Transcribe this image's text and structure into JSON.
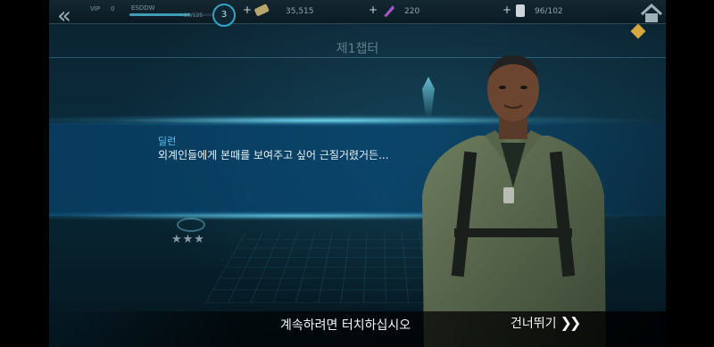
{
  "topbar": {
    "back_icon": "double-chevron-left-icon",
    "vip_label": "VIP",
    "vip_level": "0",
    "user_name": "ESDDW",
    "exp_text": "90/125",
    "exp_fraction": 0.72,
    "player_level": "3",
    "resources": [
      {
        "name": "credits",
        "icon": "credits-icon",
        "value": "35,515"
      },
      {
        "name": "energy",
        "icon": "energy-icon",
        "value": "220"
      },
      {
        "name": "stamina",
        "icon": "stamina-icon",
        "value": "96/102"
      }
    ],
    "home_icon": "home-icon"
  },
  "chapter": {
    "title": "제1챕터"
  },
  "map": {
    "stars": "★★★"
  },
  "dialogue": {
    "speaker": "딜런",
    "text": "외계인들에게 본때를 보여주고 싶어 근질거렸거든..."
  },
  "footer": {
    "continue_hint": "계속하려면 터치하십시오",
    "skip_label": "건너뛰기",
    "skip_icon": "double-chevron-right-icon"
  },
  "colors": {
    "accent": "#58c6f0",
    "band": "#0a466e",
    "quest_marker": "#d6a840"
  }
}
